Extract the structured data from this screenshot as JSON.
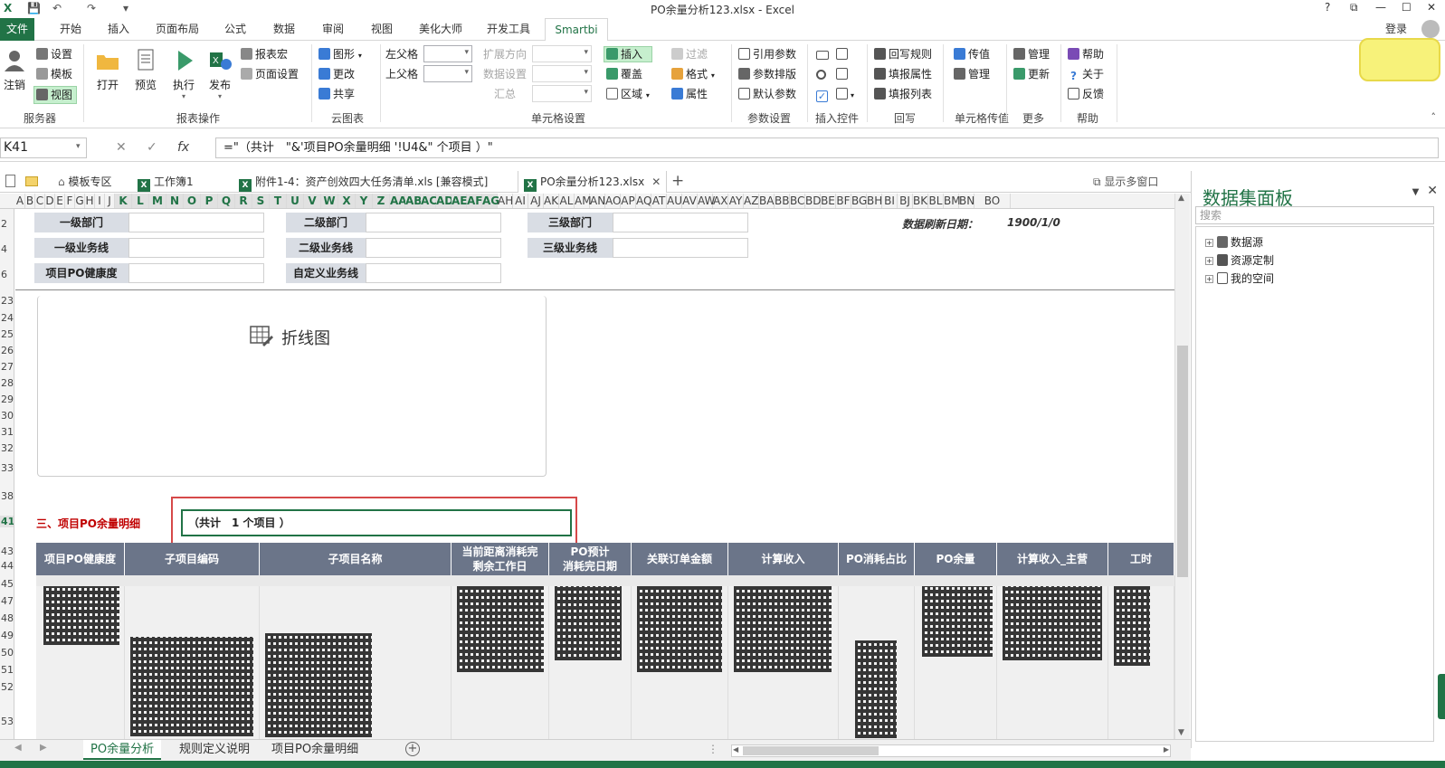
{
  "window": {
    "title": "PO余量分析123.xlsx - Excel",
    "help": "?",
    "restore": "⧉",
    "minimize": "—",
    "maximize": "☐",
    "close": "✕"
  },
  "qat": {
    "app_icon": "X",
    "save": "💾",
    "undo": "↶",
    "redo": "↷",
    "more": "▾"
  },
  "ribbon_tabs": [
    "文件",
    "开始",
    "插入",
    "页面布局",
    "公式",
    "数据",
    "审阅",
    "视图",
    "美化大师",
    "开发工具",
    "Smartbi"
  ],
  "login": "登录",
  "ribbon": {
    "server": {
      "logout": "注销",
      "settings": "设置",
      "template": "模板",
      "view": "视图",
      "label": "服务器"
    },
    "report": {
      "open": "打开",
      "preview": "预览",
      "execute": "执行",
      "publish": "发布",
      "macro": "报表宏",
      "page_setup": "页面设置",
      "label": "报表操作"
    },
    "cloud": {
      "graph": "图形",
      "change": "更改",
      "share": "共享",
      "label": "云图表"
    },
    "cell": {
      "left_parent": "左父格",
      "up_parent": "上父格",
      "expand_dir": "扩展方向",
      "data_setting": "数据设置",
      "summary": "汇总",
      "insert": "插入",
      "cover": "覆盖",
      "region": "区域",
      "filter": "过滤",
      "format": "格式",
      "property": "属性",
      "label": "单元格设置"
    },
    "param": {
      "ref_param": "引用参数",
      "param_layout": "参数排版",
      "default_param": "默认参数",
      "label": "参数设置"
    },
    "control": {
      "label": "插入控件"
    },
    "writeback": {
      "rule": "回写规则",
      "fill_prop": "填报属性",
      "fill_list": "填报列表",
      "label": "回写"
    },
    "cellpass": {
      "pass_value": "传值",
      "manage": "管理",
      "label": "单元格传值"
    },
    "more": {
      "manage": "管理",
      "update": "更新",
      "label": "更多"
    },
    "help": {
      "help": "帮助",
      "about": "关于",
      "feedback": "反馈",
      "label": "帮助"
    }
  },
  "formula_bar": {
    "name_box": "K41",
    "formula": "=\"（共计　\"&'项目PO余量明细 '!U4&\" 个项目 ）\""
  },
  "doc_tabs": [
    "模板专区",
    "工作簿1",
    "附件1-4：资产创效四大任务清单.xls [兼容模式]",
    "PO余量分析123.xlsx"
  ],
  "doc_tabs_right": "显示多窗口",
  "columns": [
    "A",
    "B",
    "C",
    "D",
    "E",
    "F",
    "G",
    "H",
    "I",
    "J",
    "K",
    "L",
    "M",
    "N",
    "O",
    "P",
    "Q",
    "R",
    "S",
    "T",
    "U",
    "V",
    "W",
    "X",
    "Y",
    "Z",
    "AA",
    "AB",
    "AC",
    "AD",
    "AE",
    "AF",
    "AG",
    "AH",
    "AI",
    "AJ",
    "AK",
    "AL",
    "AM",
    "AN",
    "AO",
    "AP",
    "AQ",
    "AT",
    "AU",
    "AV",
    "AW",
    "AX",
    "AY",
    "AZ",
    "BA",
    "BB",
    "BC",
    "BD",
    "BE",
    "BF",
    "BG",
    "BH",
    "BI",
    "BJ",
    "BK",
    "BL",
    "BM",
    "BN",
    "BO"
  ],
  "rows": [
    "2",
    "4",
    "6",
    "23",
    "24",
    "25",
    "26",
    "27",
    "28",
    "29",
    "30",
    "31",
    "32",
    "33",
    "38",
    "41",
    "43",
    "44",
    "45",
    "47",
    "48",
    "49",
    "50",
    "51",
    "52",
    "53"
  ],
  "filters": {
    "dept1": "一级部门",
    "dept2": "二级部门",
    "dept3": "三级部门",
    "biz1": "一级业务线",
    "biz2": "二级业务线",
    "biz3": "三级业务线",
    "health": "项目PO健康度",
    "custom_biz": "自定义业务线",
    "refresh_label": "数据刷新日期：",
    "refresh_value": "1900/1/0"
  },
  "chart_placeholder": "折线图",
  "section3": "三、项目PO余量明细",
  "count_text": "（共计　1 个项目 ）",
  "table_headers": [
    "项目PO健康度",
    "子项目编码",
    "子项目名称",
    "当前距离消耗完\n剩余工作日",
    "PO预计\n消耗完日期",
    "关联订单金额",
    "计算收入",
    "PO消耗占比",
    "PO余量",
    "计算收入_主营",
    "工时"
  ],
  "panel": {
    "title": "数据集面板",
    "search_placeholder": "搜索",
    "tree": [
      "数据源",
      "资源定制",
      "我的空间"
    ]
  },
  "sheet_tabs": [
    "PO余量分析",
    "规则定义说明",
    "项目PO余量明细"
  ],
  "colors": {
    "excel_green": "#217346",
    "header_bg": "#6b7589",
    "label_bg": "#d9dde4",
    "highlight_red": "#d64949"
  }
}
